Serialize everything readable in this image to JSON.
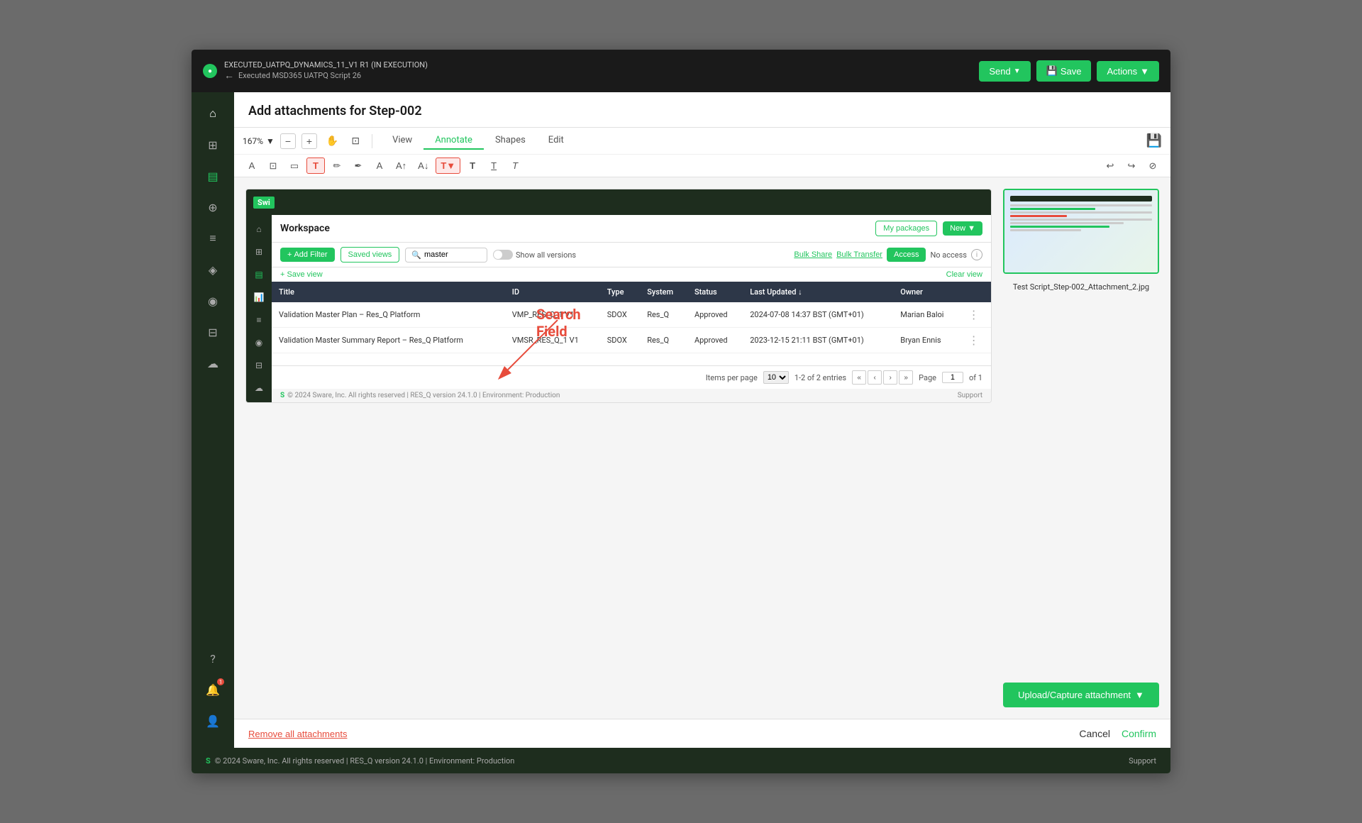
{
  "topbar": {
    "title": "EXECUTED_UATPQ_DYNAMICS_11_V1 R1 (IN EXECUTION)",
    "subtitle": "Executed MSD365 UATPQ Script 26",
    "send_label": "Send",
    "save_label": "Save",
    "actions_label": "Actions"
  },
  "dialog": {
    "title": "Add attachments for Step-002"
  },
  "toolbar": {
    "zoom": "167%",
    "tabs": [
      "View",
      "Annotate",
      "Shapes",
      "Edit"
    ]
  },
  "workspace": {
    "title": "Workspace",
    "my_packages": "My packages",
    "new_label": "New",
    "add_filter": "Add Filter",
    "saved_views": "Saved views",
    "search_value": "master",
    "show_all_versions": "Show all versions",
    "bulk_share": "Bulk Share",
    "bulk_transfer": "Bulk Transfer",
    "access_label": "Access",
    "no_access": "No access",
    "save_view": "Save view",
    "clear_view": "Clear view",
    "columns": [
      "Title",
      "ID",
      "Type",
      "System",
      "Status",
      "Last Updated ↓",
      "Owner"
    ],
    "rows": [
      {
        "title": "Validation Master Plan – Res_Q Platform",
        "id": "VMP_RES_Q_1 V1",
        "type": "SDOX",
        "system": "Res_Q",
        "status": "Approved",
        "last_updated": "2024-07-08 14:37 BST (GMT+01)",
        "owner": "Marian Baloi"
      },
      {
        "title": "Validation Master Summary Report – Res_Q Platform",
        "id": "VMSR_RES_Q_1 V1",
        "type": "SDOX",
        "system": "Res_Q",
        "status": "Approved",
        "last_updated": "2023-12-15 21:11 BST (GMT+01)",
        "owner": "Bryan Ennis"
      }
    ],
    "items_per_page": "Items per page",
    "per_page_value": "10",
    "entries_info": "1-2 of 2 entries",
    "page_label": "Page",
    "page_num": "1",
    "of_pages": "of 1"
  },
  "annotation": {
    "label": "Search\nField"
  },
  "attachment": {
    "name": "Test Script_Step-002_Attachment_2.jpg",
    "upload_label": "Upload/Capture attachment"
  },
  "bottom": {
    "remove_label": "Remove all attachments",
    "cancel_label": "Cancel",
    "confirm_label": "Confirm"
  },
  "footer": {
    "brand": "© 2024 Sware, Inc. All rights reserved | RES_Q version 24.1.0 | Environment: Production",
    "support": "Support"
  },
  "sidebar": {
    "icons": [
      "⌂",
      "⊞",
      "⊕",
      "⊘",
      "≡",
      "◈",
      "◉",
      "⊟",
      "⊠",
      "⊡"
    ]
  }
}
